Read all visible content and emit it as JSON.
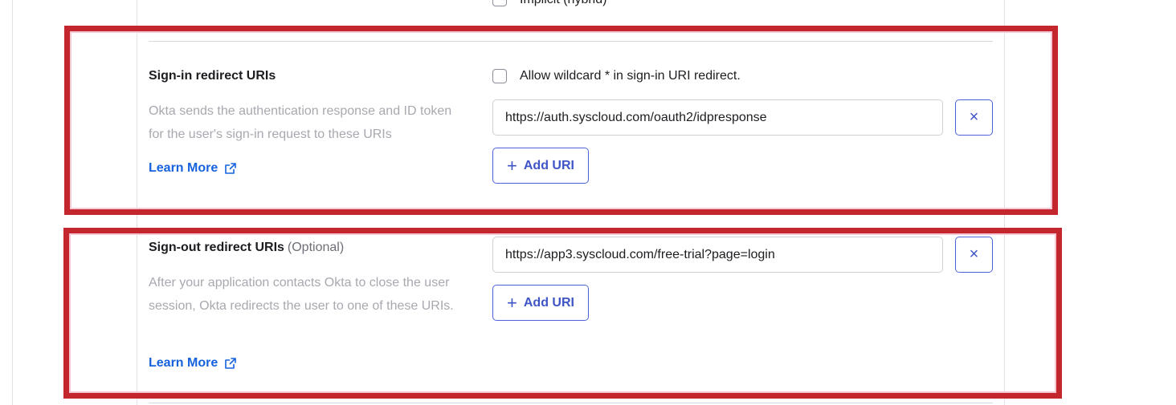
{
  "top": {
    "option_label": "Implicit (hybrid)"
  },
  "sign_in": {
    "title": "Sign-in redirect URIs",
    "description": "Okta sends the authentication response and ID token for the user's sign-in request to these URIs",
    "learn_more": "Learn More",
    "wildcard_label": "Allow wildcard * in sign-in URI redirect.",
    "uri_value": "https://auth.syscloud.com/oauth2/idpresponse",
    "add_label": "Add URI",
    "remove_glyph": "×"
  },
  "sign_out": {
    "title": "Sign-out redirect URIs",
    "optional": "(Optional)",
    "description": "After your application contacts Okta to close the user session, Okta redirects the user to one of these URIs.",
    "learn_more": "Learn More",
    "uri_value": "https://app3.syscloud.com/free-trial?page=login",
    "add_label": "Add URI",
    "remove_glyph": "×"
  },
  "icons": {
    "external_link": "external-link-icon",
    "plus": "plus-icon",
    "close": "close-icon"
  },
  "colors": {
    "highlight": "#c4262e",
    "link": "#1662dd",
    "button": "#3f55c6",
    "muted_text": "#a8a8b0"
  }
}
